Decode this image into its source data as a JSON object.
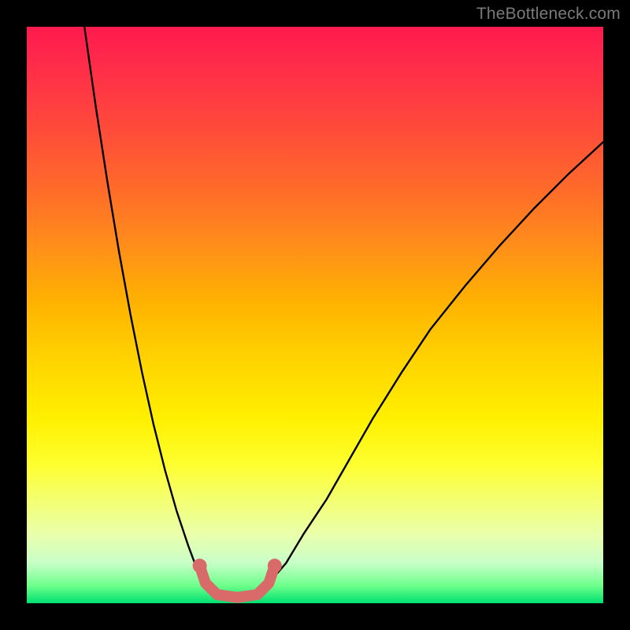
{
  "watermark": "TheBottleneck.com",
  "chart_data": {
    "type": "line",
    "title": "",
    "xlabel": "",
    "ylabel": "",
    "xlim": [
      0,
      100
    ],
    "ylim": [
      0,
      100
    ],
    "grid": false,
    "series": [
      {
        "name": "left-curve",
        "x": [
          10,
          12,
          14,
          16,
          18,
          20,
          22,
          24,
          26,
          28,
          29.5,
          31,
          33
        ],
        "values": [
          100,
          86,
          73,
          61,
          50,
          40,
          31,
          23,
          16,
          10,
          6,
          3.5,
          1.5
        ]
      },
      {
        "name": "right-curve",
        "x": [
          40,
          42,
          45,
          48,
          52,
          56,
          60,
          65,
          70,
          76,
          82,
          88,
          94,
          100
        ],
        "values": [
          1.5,
          3.5,
          7,
          12,
          18,
          25,
          32,
          40,
          47.5,
          55,
          62,
          68.5,
          74.5,
          80
        ]
      },
      {
        "name": "valley-marker",
        "x": [
          30,
          31,
          33,
          36.5,
          40,
          42,
          43
        ],
        "values": [
          6.5,
          3.5,
          1.5,
          1.0,
          1.5,
          3.5,
          6.5
        ]
      }
    ],
    "markers": [
      {
        "series": "valley-marker",
        "x": 30,
        "value": 6.5
      },
      {
        "series": "valley-marker",
        "x": 43,
        "value": 6.5
      }
    ],
    "colors": {
      "curve_stroke": "#000000",
      "valley_stroke": "#d96a6a",
      "gradient_top": "#ff1a4d",
      "gradient_bottom": "#00e070"
    }
  }
}
